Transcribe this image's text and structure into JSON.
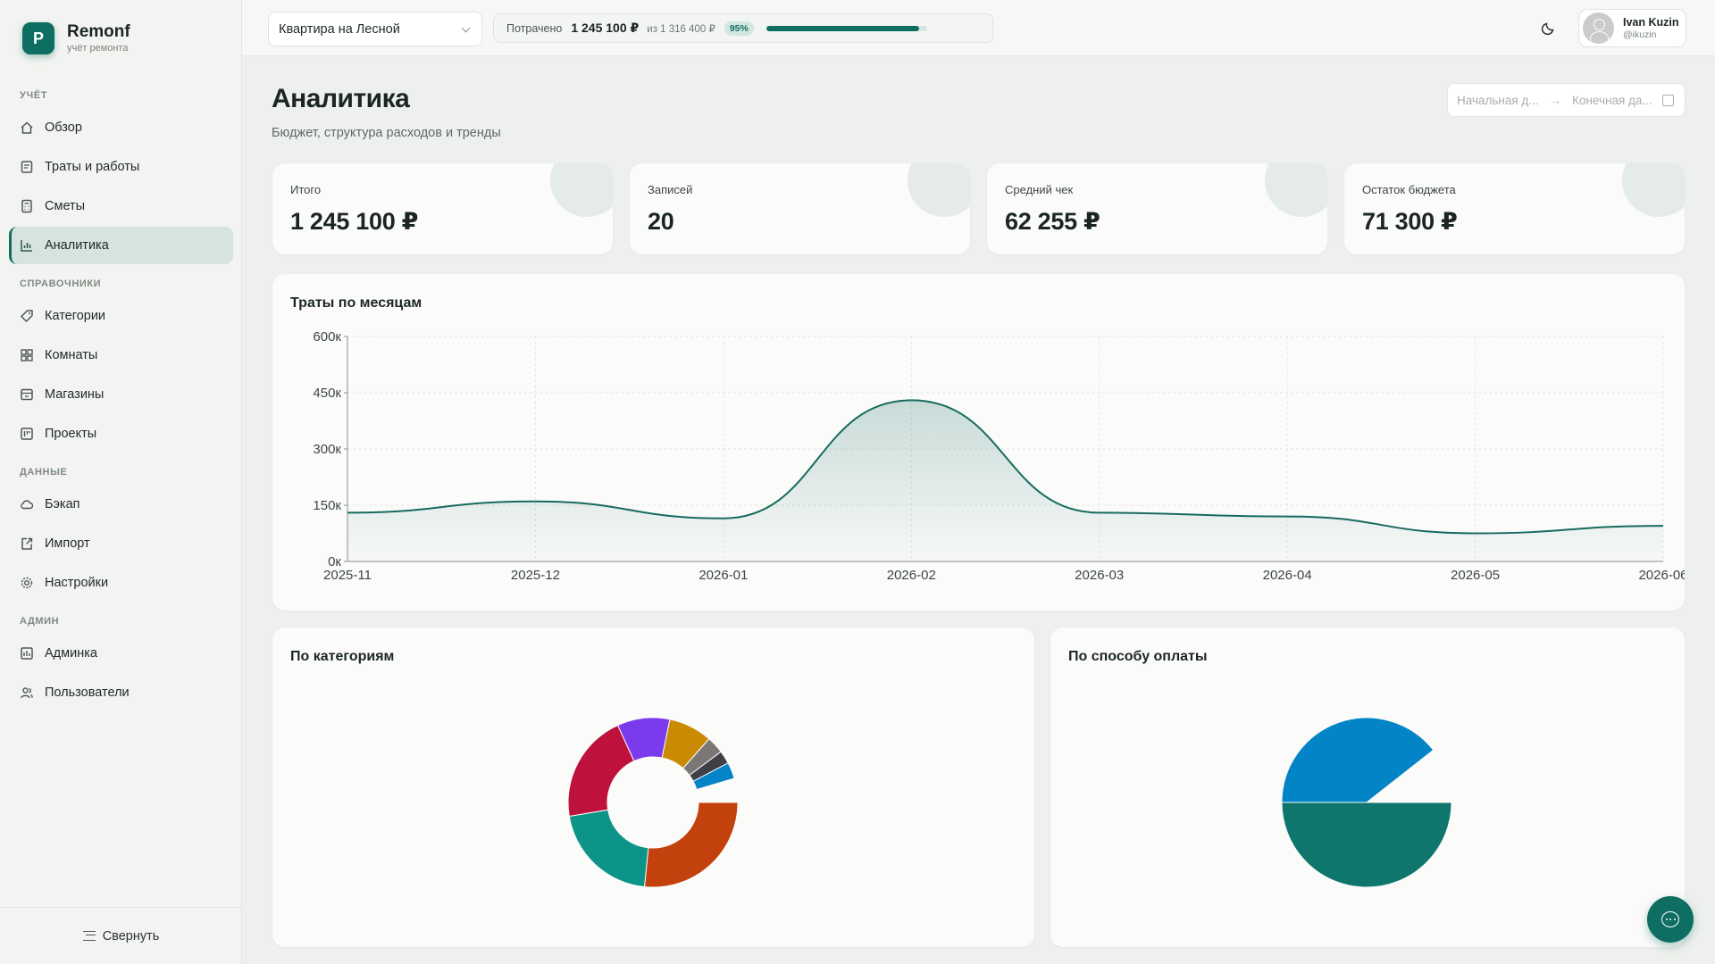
{
  "brand": {
    "initial": "Р",
    "name": "Remonf",
    "subtitle": "учёт ремонта"
  },
  "sidebar": {
    "sections": [
      {
        "title": "УЧЁТ",
        "items": [
          {
            "label": "Обзор",
            "icon": "home-icon"
          },
          {
            "label": "Траты и работы",
            "icon": "receipt-icon"
          },
          {
            "label": "Сметы",
            "icon": "calculator-icon"
          },
          {
            "label": "Аналитика",
            "icon": "chart-icon",
            "active": true
          }
        ]
      },
      {
        "title": "СПРАВОЧНИКИ",
        "items": [
          {
            "label": "Категории",
            "icon": "tag-icon"
          },
          {
            "label": "Комнаты",
            "icon": "grid-icon"
          },
          {
            "label": "Магазины",
            "icon": "store-icon"
          },
          {
            "label": "Проекты",
            "icon": "kanban-icon"
          }
        ]
      },
      {
        "title": "ДАННЫЕ",
        "items": [
          {
            "label": "Бэкап",
            "icon": "cloud-icon"
          },
          {
            "label": "Импорт",
            "icon": "import-icon"
          },
          {
            "label": "Настройки",
            "icon": "gear-icon"
          }
        ]
      },
      {
        "title": "АДМИН",
        "items": [
          {
            "label": "Админка",
            "icon": "admin-icon"
          },
          {
            "label": "Пользователи",
            "icon": "users-icon"
          }
        ]
      }
    ],
    "collapse_label": "Свернуть"
  },
  "topbar": {
    "project": "Квартира на Лесной",
    "spent_label": "Потрачено",
    "spent_amount": "1 245 100 ₽",
    "budget_of": "из 1 316 400 ₽",
    "percent_label": "95%",
    "progress": 0.95,
    "user_name": "Ivan Kuzin",
    "user_handle": "@ikuzin"
  },
  "page": {
    "title": "Аналитика",
    "subtitle": "Бюджет, структура расходов и тренды",
    "date_start_placeholder": "Начальная д...",
    "date_end_placeholder": "Конечная да...",
    "date_arrow": "→"
  },
  "kpis": [
    {
      "label": "Итого",
      "value": "1 245 100 ₽"
    },
    {
      "label": "Записей",
      "value": "20"
    },
    {
      "label": "Средний чек",
      "value": "62 255 ₽"
    },
    {
      "label": "Остаток бюджета",
      "value": "71 300 ₽"
    }
  ],
  "cards": {
    "monthly_title": "Траты по месяцам",
    "categories_title": "По категориям",
    "payment_title": "По способу оплаты"
  },
  "colors": {
    "accent": "#0f6e62",
    "line": "#176b5f"
  },
  "chart_data": [
    {
      "type": "area",
      "title": "Траты по месяцам",
      "categories": [
        "2025-11",
        "2025-12",
        "2026-01",
        "2026-02",
        "2026-03",
        "2026-04",
        "2026-05",
        "2026-06"
      ],
      "values": [
        130000,
        160000,
        115000,
        430000,
        130000,
        120000,
        75000,
        95000
      ],
      "ylim": [
        0,
        600000
      ],
      "yticks": [
        0,
        150000,
        300000,
        450000,
        600000
      ],
      "ytick_labels": [
        "0к",
        "150к",
        "300к",
        "450к",
        "600к"
      ],
      "grid": true
    },
    {
      "type": "pie",
      "title": "По категориям",
      "donut": true,
      "values": [
        26.6,
        20.8,
        20.8,
        10.0,
        8.3,
        3.3,
        2.5,
        3.1
      ],
      "colors": [
        "#c2410c",
        "#0d9488",
        "#be123c",
        "#7c3aed",
        "#ca8a04",
        "#7a7775",
        "#3f3f46",
        "#0284c7"
      ]
    },
    {
      "type": "pie",
      "title": "По способу оплаты",
      "donut": false,
      "values": [
        50,
        39.4
      ],
      "colors": [
        "#0f766e",
        "#0284c7"
      ]
    }
  ]
}
